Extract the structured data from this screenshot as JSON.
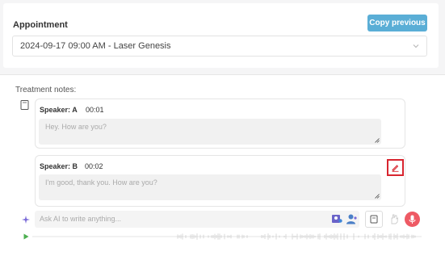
{
  "appointment": {
    "label": "Appointment",
    "copy_button": "Copy previous",
    "selected": "2024-09-17 09:00 AM - Laser Genesis"
  },
  "notes": {
    "title": "Treatment notes:",
    "entries": [
      {
        "speaker": "Speaker: A",
        "time": "00:01",
        "text": "Hey. How are you?"
      },
      {
        "speaker": "Speaker: B",
        "time": "00:02",
        "text": "I'm good, thank you. How are you?"
      }
    ]
  },
  "ai": {
    "placeholder": "Ask AI to write anything..."
  },
  "colors": {
    "accent": "#5aaed6",
    "highlight": "#d8252f",
    "mic": "#ee5a64",
    "play": "#4caf50"
  },
  "icons": [
    "chevron-down-icon",
    "document-icon",
    "pencil-icon",
    "sparkle-icon",
    "image-people-icon",
    "person-icon",
    "save-icon",
    "hand-icon",
    "microphone-icon",
    "play-icon",
    "resize-handle-icon"
  ]
}
